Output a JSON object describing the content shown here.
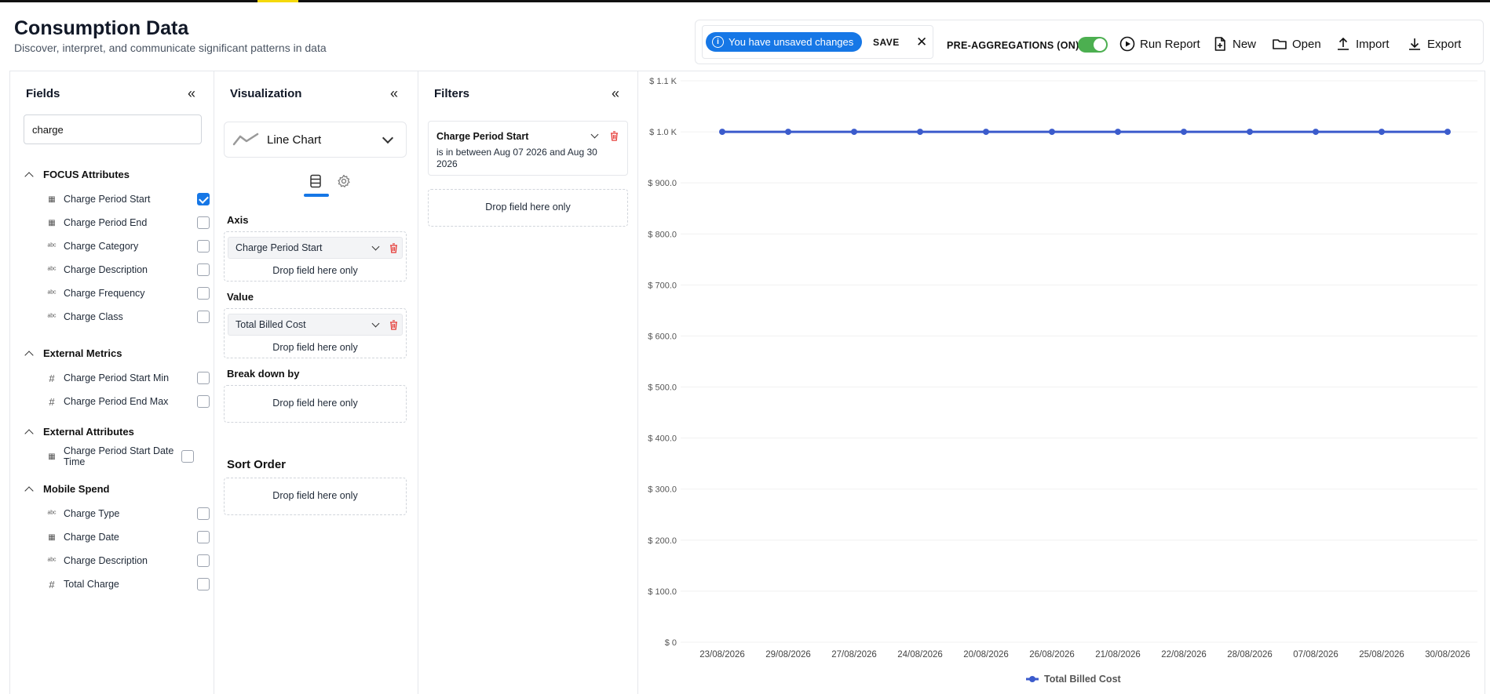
{
  "header": {
    "title": "Consumption Data",
    "subtitle": "Discover, interpret, and communicate significant patterns in data"
  },
  "toolbar": {
    "unsaved_text": "You have unsaved changes",
    "save_label": "SAVE",
    "close_symbol": "✕",
    "preagg_label": "PRE-AGGREGATIONS (ON)",
    "preagg_on": true,
    "buttons": [
      {
        "label": "Run Report",
        "icon": "play-circle-icon"
      },
      {
        "label": "New",
        "icon": "file-plus-icon"
      },
      {
        "label": "Open",
        "icon": "folder-icon"
      },
      {
        "label": "Import",
        "icon": "upload-icon"
      },
      {
        "label": "Export",
        "icon": "download-icon"
      }
    ]
  },
  "fields_panel": {
    "title": "Fields",
    "collapse_symbol": "«",
    "search_value": "charge",
    "groups": [
      {
        "title": "FOCUS Attributes",
        "items": [
          {
            "label": "Charge Period Start",
            "type": "date",
            "checked": true
          },
          {
            "label": "Charge Period End",
            "type": "date",
            "checked": false
          },
          {
            "label": "Charge Category",
            "type": "text",
            "checked": false
          },
          {
            "label": "Charge Description",
            "type": "text",
            "checked": false
          },
          {
            "label": "Charge Frequency",
            "type": "text",
            "checked": false
          },
          {
            "label": "Charge Class",
            "type": "text",
            "checked": false
          }
        ]
      },
      {
        "title": "External Metrics",
        "items": [
          {
            "label": "Charge Period Start Min",
            "type": "number",
            "checked": false
          },
          {
            "label": "Charge Period End Max",
            "type": "number",
            "checked": false
          }
        ]
      },
      {
        "title": "External Attributes",
        "items": [
          {
            "label": "Charge Period Start Date Time",
            "type": "date",
            "checked": false
          }
        ]
      },
      {
        "title": "Mobile Spend",
        "items": [
          {
            "label": "Charge Type",
            "type": "text",
            "checked": false
          },
          {
            "label": "Charge Date",
            "type": "date",
            "checked": false
          },
          {
            "label": "Charge Description",
            "type": "text",
            "checked": false
          },
          {
            "label": "Total Charge",
            "type": "number",
            "checked": false
          }
        ]
      }
    ]
  },
  "viz_panel": {
    "title": "Visualization",
    "collapse_symbol": "«",
    "chart_type": "Line Chart",
    "axis_label": "Axis",
    "axis_field": "Charge Period Start",
    "value_label": "Value",
    "value_field": "Total Billed Cost",
    "breakdown_label": "Break down by",
    "sort_label": "Sort Order",
    "drop_text": "Drop field here only"
  },
  "filters_panel": {
    "title": "Filters",
    "collapse_symbol": "«",
    "filter_field": "Charge Period Start",
    "filter_desc": "is in between Aug 07 2026 and Aug 30 2026",
    "drop_text": "Drop field here only"
  },
  "colors": {
    "accent": "#1677e6",
    "series": "#3b5bcc",
    "toggle_on": "#4caf50",
    "danger": "#e53935"
  },
  "chart_data": {
    "type": "line",
    "categories": [
      "23/08/2026",
      "29/08/2026",
      "27/08/2026",
      "24/08/2026",
      "20/08/2026",
      "26/08/2026",
      "21/08/2026",
      "22/08/2026",
      "28/08/2026",
      "07/08/2026",
      "25/08/2026",
      "30/08/2026"
    ],
    "series": [
      {
        "name": "Total Billed Cost",
        "values": [
          1000,
          1000,
          1000,
          1000,
          1000,
          1000,
          1000,
          1000,
          1000,
          1000,
          1000,
          1000
        ]
      }
    ],
    "y_ticks": [
      "$ 0",
      "$ 100.0",
      "$ 200.0",
      "$ 300.0",
      "$ 400.0",
      "$ 500.0",
      "$ 600.0",
      "$ 700.0",
      "$ 800.0",
      "$ 900.0",
      "$ 1.0 K",
      "$ 1.1 K"
    ],
    "ylim": [
      0,
      1100
    ],
    "grid": true,
    "legend": "bottom-center"
  }
}
